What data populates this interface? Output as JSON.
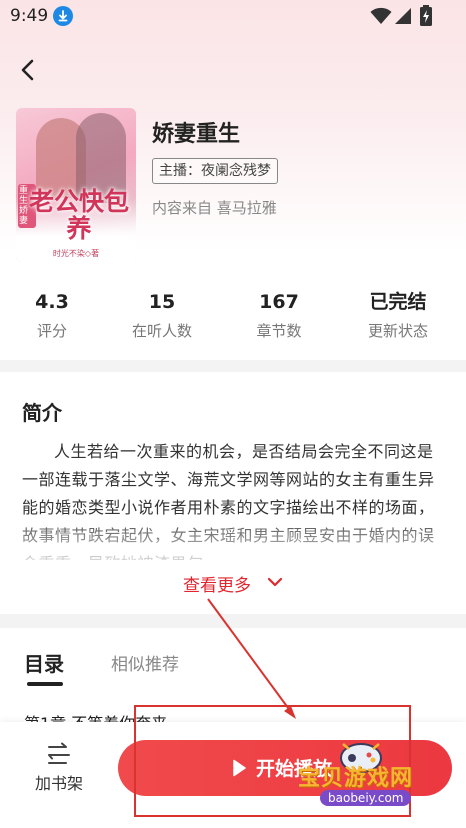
{
  "status_bar": {
    "time": "9:49"
  },
  "book": {
    "title": "娇妻重生",
    "narrator": "主播：夜阑念残梦",
    "source": "内容来自 喜马拉雅",
    "cover": {
      "title": "老公快包养",
      "badge": "重生娇妻",
      "author": "时光不染◇著"
    }
  },
  "stats": [
    {
      "value": "4.3",
      "label": "评分"
    },
    {
      "value": "15",
      "label": "在听人数"
    },
    {
      "value": "167",
      "label": "章节数"
    },
    {
      "value": "已完结",
      "label": "更新状态"
    }
  ],
  "intro": {
    "heading": "简介",
    "text": "人生若给一次重来的机会，是否结局会完全不同这是一部连载于落尘文学、海荒文学网等网站的女主有重生异能的婚恋类型小说作者用朴素的文字描绘出不样的场面，故事情节跌宕起伏，女主宋瑶和男主顾昱安由于婚内的误会重重，导致她被渣男勾",
    "more": "查看更多"
  },
  "tabs": {
    "catalog": "目录",
    "similar": "相似推荐"
  },
  "chapters": [
    "第1章 不等着你奔来"
  ],
  "bottom_bar": {
    "shelf_label": "加书架",
    "play_label": "开始播放"
  },
  "watermark": {
    "text": "宝贝游戏网",
    "url": "baobeiy.com"
  },
  "colors": {
    "accent": "#ec3840",
    "link": "#e0262f"
  }
}
